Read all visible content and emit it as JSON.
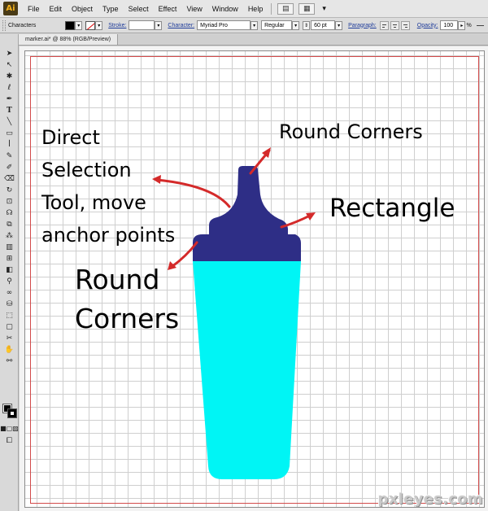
{
  "app": {
    "logo": "Ai"
  },
  "menu": [
    "File",
    "Edit",
    "Object",
    "Type",
    "Select",
    "Effect",
    "View",
    "Window",
    "Help"
  ],
  "control_bar": {
    "panel_label": "Characters",
    "stroke_label": "Stroke:",
    "character_label": "Character:",
    "font_family": "Myriad Pro",
    "font_style": "Regular",
    "font_size": "60 pt",
    "paragraph_label": "Paragraph:",
    "opacity_label": "Opacity:",
    "opacity_value": "100",
    "opacity_unit": "%"
  },
  "document": {
    "tab_title": "marker.ai* @ 88% (RGB/Preview)"
  },
  "annotations": {
    "direct_selection": [
      "Direct",
      "Selection",
      "Tool, move",
      "anchor points"
    ],
    "round_corners_top": "Round Corners",
    "rectangle": "Rectangle",
    "round_corners_left": [
      "Round",
      "Corners"
    ]
  },
  "watermark": "pxleyes.com",
  "colors": {
    "marker_cap": "#2e2e86",
    "marker_body": "#00f5f5",
    "arrows": "#d42a2a",
    "bleed_guide": "#d24a4a",
    "grid": "#cfcfcf"
  },
  "icons": {
    "tools": [
      "selection-tool-icon",
      "direct-selection-tool-icon",
      "magic-wand-icon",
      "lasso-icon",
      "pen-tool-icon",
      "type-tool-icon",
      "line-tool-icon",
      "rectangle-tool-icon",
      "paintbrush-icon",
      "pencil-icon",
      "blob-brush-icon",
      "eraser-icon",
      "rotate-tool-icon",
      "scale-tool-icon",
      "warp-tool-icon",
      "free-transform-icon",
      "symbol-sprayer-icon",
      "column-graph-icon",
      "mesh-tool-icon",
      "gradient-tool-icon",
      "eyedropper-icon",
      "blend-tool-icon",
      "live-paint-bucket-icon",
      "live-paint-selection-icon",
      "artboard-tool-icon",
      "slice-tool-icon",
      "hand-tool-icon",
      "zoom-tool-icon"
    ]
  }
}
